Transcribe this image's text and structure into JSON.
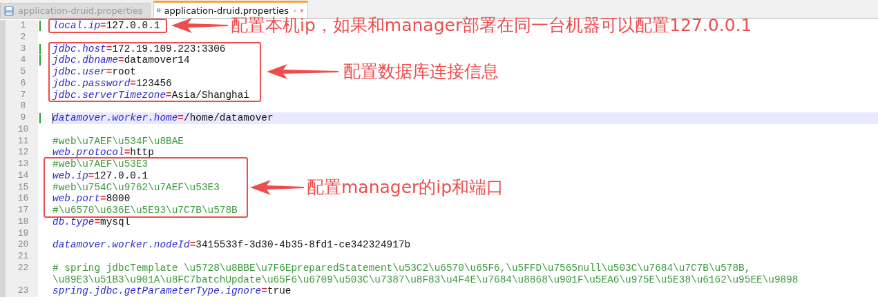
{
  "tabs": [
    {
      "label": "application-druid.properties",
      "selected": false
    },
    {
      "label": "application-druid.properties",
      "selected": true
    }
  ],
  "lines": [
    {
      "number": "1",
      "changed": true,
      "current": false,
      "kind": "property",
      "key": "local.ip",
      "separator": "=",
      "value": "127.0.0.1"
    },
    {
      "number": "2",
      "changed": false,
      "current": false,
      "kind": "blank"
    },
    {
      "number": "3",
      "changed": true,
      "current": false,
      "kind": "property",
      "key": "jdbc.host",
      "separator": "=",
      "value": "172.19.109.223:3306"
    },
    {
      "number": "4",
      "changed": true,
      "current": false,
      "kind": "property",
      "key": "jdbc.dbname",
      "separator": "=",
      "value": "datamover14"
    },
    {
      "number": "5",
      "changed": false,
      "current": false,
      "kind": "property",
      "key": "jdbc.user",
      "separator": "=",
      "value": "root"
    },
    {
      "number": "6",
      "changed": false,
      "current": false,
      "kind": "property",
      "key": "jdbc.password",
      "separator": "=",
      "value": "123456"
    },
    {
      "number": "7",
      "changed": false,
      "current": false,
      "kind": "property",
      "key": "jdbc.serverTimezone",
      "separator": "=",
      "value": "Asia/Shanghai"
    },
    {
      "number": "8",
      "changed": false,
      "current": false,
      "kind": "blank"
    },
    {
      "number": "9",
      "changed": true,
      "current": true,
      "kind": "property",
      "key": "datamover.worker.home",
      "separator": "=",
      "value": "/home/datamover"
    },
    {
      "number": "10",
      "changed": false,
      "current": false,
      "kind": "blank"
    },
    {
      "number": "11",
      "changed": false,
      "current": false,
      "kind": "comment",
      "segments": [
        "#web\\u7AEF\\u534F\\u8BAE"
      ]
    },
    {
      "number": "12",
      "changed": false,
      "current": false,
      "kind": "property",
      "key": "web.protocol",
      "separator": "=",
      "value": "http"
    },
    {
      "number": "13",
      "changed": false,
      "current": false,
      "kind": "comment",
      "segments": [
        "#web\\u7AEF\\u53E3"
      ]
    },
    {
      "number": "14",
      "changed": false,
      "current": false,
      "kind": "property",
      "key": "web.ip",
      "separator": "=",
      "value": "127.0.0.1"
    },
    {
      "number": "15",
      "changed": false,
      "current": false,
      "kind": "comment",
      "segments": [
        "#web\\u754C\\u9762\\u7AEF\\u53E3"
      ]
    },
    {
      "number": "16",
      "changed": false,
      "current": false,
      "kind": "property",
      "key": "web.port",
      "separator": "=",
      "value": "8000"
    },
    {
      "number": "17",
      "changed": false,
      "current": false,
      "kind": "comment",
      "segments": [
        "#\\u6570\\u636E\\u5E93\\u7C7B\\u578B"
      ]
    },
    {
      "number": "18",
      "changed": false,
      "current": false,
      "kind": "property",
      "key": "db.type",
      "separator": "=",
      "value": "mysql"
    },
    {
      "number": "19",
      "changed": false,
      "current": false,
      "kind": "blank"
    },
    {
      "number": "20",
      "changed": false,
      "current": false,
      "kind": "property",
      "key": "datamover.worker.nodeId",
      "separator": "=",
      "value": "3415533f-3d30-4b35-8fd1-ce342324917b"
    },
    {
      "number": "21",
      "changed": false,
      "current": false,
      "kind": "blank"
    },
    {
      "number": "22",
      "changed": false,
      "current": false,
      "kind": "comment",
      "segments": [
        "# spring jdbcTemplate \\u5728\\u8BBE\\u7F6EpreparedStatement\\u53C2\\u6570\\u65F6,\\u5FFD\\u7565null\\u503C\\u7684\\u7C7B\\u578B,",
        "\\u89E3\\u51B3\\u901A\\u8FC7batchUpdate\\u65F6\\u6709\\u503C\\u7387\\u8F83\\u4F4E\\u7684\\u8868\\u901F\\u5EA6\\u975E\\u5E38\\u6162\\u95EE\\u9898"
      ]
    },
    {
      "number": "23",
      "changed": false,
      "current": false,
      "kind": "property",
      "key": "spring.jdbc.getParameterType.ignore",
      "separator": "=",
      "value": "true"
    }
  ],
  "annotations": [
    {
      "label": "配置本机ip，如果和manager部署在同一台机器可以配置127.0.0.1"
    },
    {
      "label": "配置数据库连接信息"
    },
    {
      "label": "配置manager的ip和端口"
    }
  ]
}
